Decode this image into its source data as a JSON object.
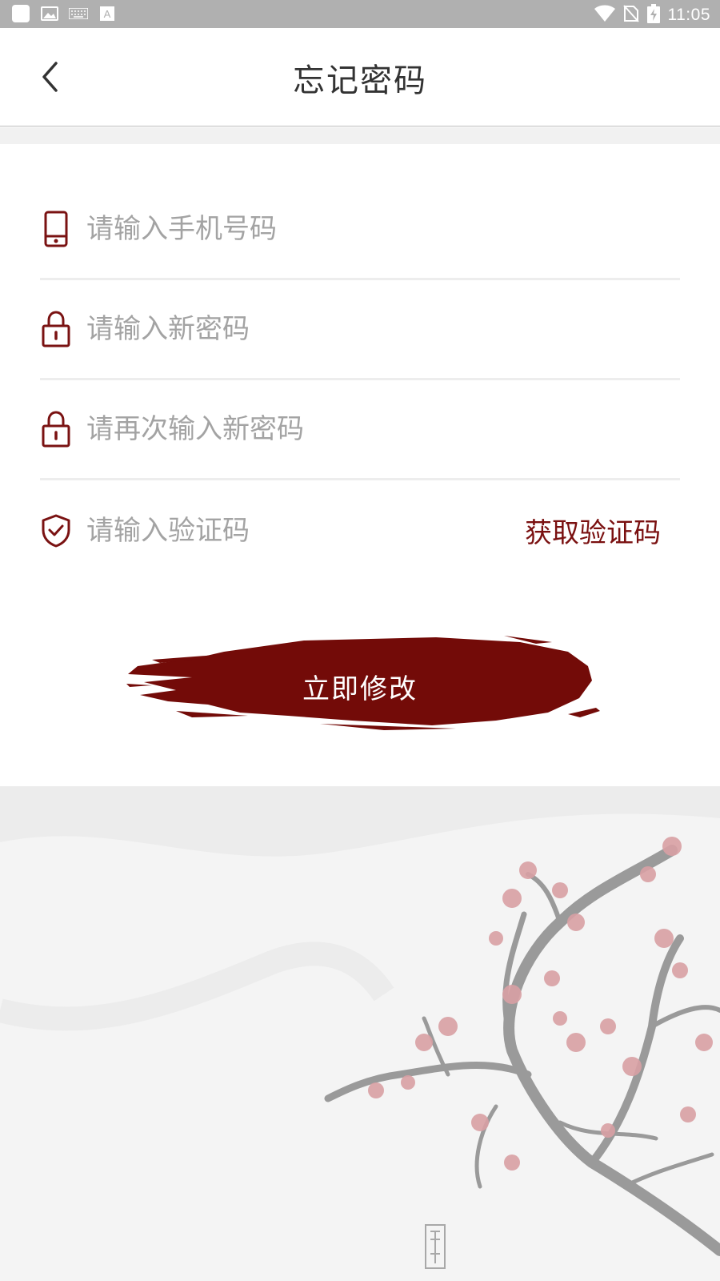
{
  "status_bar": {
    "time": "11:05",
    "left_icons": [
      "app-icon",
      "image-icon",
      "keyboard-icon",
      "text-icon"
    ],
    "right_icons": [
      "wifi-icon",
      "no-sim-icon",
      "battery-charging-icon"
    ]
  },
  "header": {
    "title": "忘记密码",
    "back_icon": "chevron-left-icon"
  },
  "form": {
    "phone": {
      "placeholder": "请输入手机号码",
      "icon": "phone-icon"
    },
    "new_password": {
      "placeholder": "请输入新密码",
      "icon": "lock-icon"
    },
    "confirm_password": {
      "placeholder": "请再次输入新密码",
      "icon": "lock-icon"
    },
    "verification": {
      "placeholder": "请输入验证码",
      "icon": "shield-check-icon",
      "get_code_label": "获取验证码"
    },
    "submit_label": "立即修改"
  },
  "colors": {
    "accent": "#7a0c0c",
    "status_bar": "#b0b0b0",
    "placeholder": "#a3a3a3"
  }
}
